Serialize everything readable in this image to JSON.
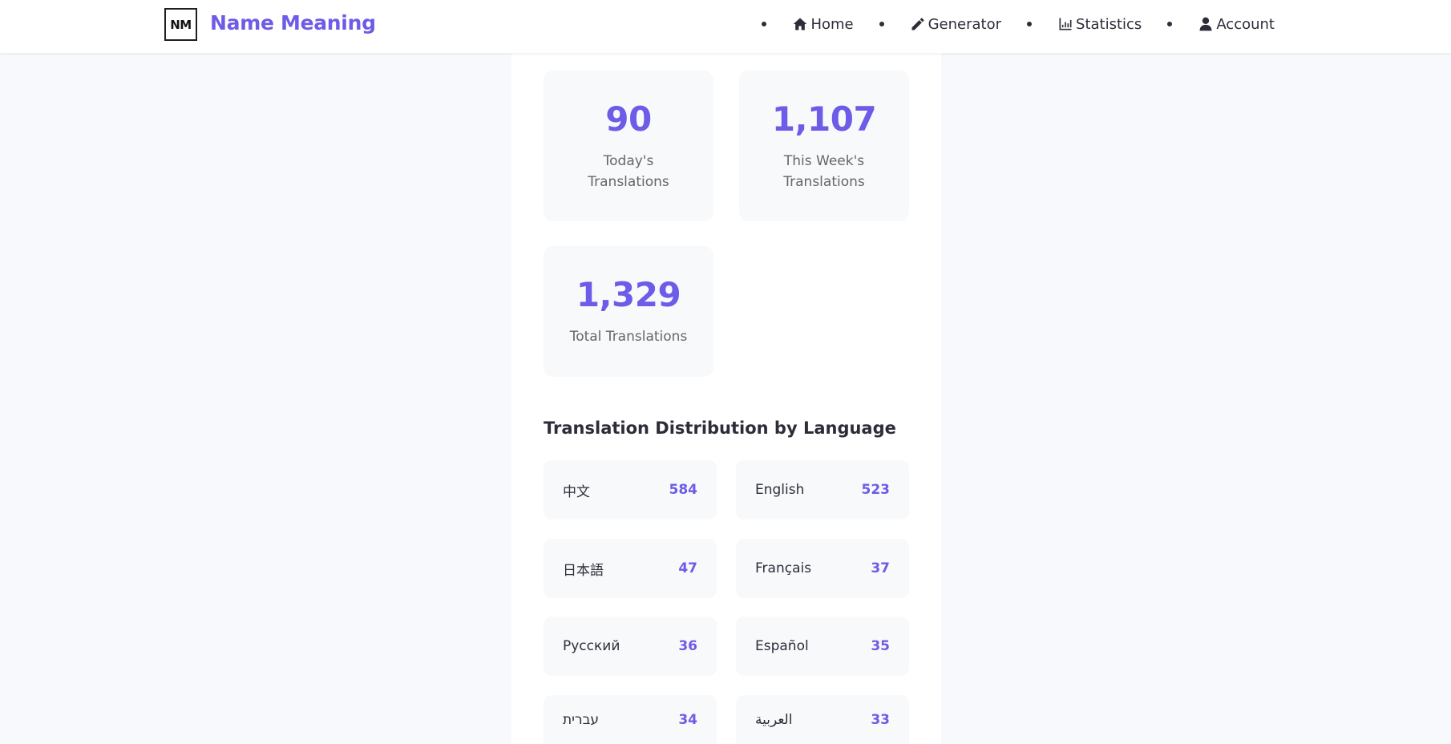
{
  "header": {
    "logo_text": "NM",
    "brand": "Name Meaning",
    "nav": [
      {
        "label": "Home",
        "icon": "home-icon"
      },
      {
        "label": "Generator",
        "icon": "pencil-icon"
      },
      {
        "label": "Statistics",
        "icon": "chart-icon"
      },
      {
        "label": "Account",
        "icon": "user-icon"
      }
    ]
  },
  "stats": [
    {
      "value": "90",
      "label": "Today's Translations"
    },
    {
      "value": "1,107",
      "label": "This Week's Translations"
    },
    {
      "value": "1,329",
      "label": "Total Translations"
    }
  ],
  "distribution": {
    "title": "Translation Distribution by Language",
    "items": [
      {
        "language": "中文",
        "count": "584"
      },
      {
        "language": "English",
        "count": "523"
      },
      {
        "language": "日本語",
        "count": "47"
      },
      {
        "language": "Français",
        "count": "37"
      },
      {
        "language": "Русский",
        "count": "36"
      },
      {
        "language": "Español",
        "count": "35"
      },
      {
        "language": "עברית",
        "count": "34"
      },
      {
        "language": "العربية",
        "count": "33"
      }
    ]
  },
  "colors": {
    "accent": "#6c5ce7",
    "text": "#2d2d3a",
    "background": "#f8f9fc"
  }
}
